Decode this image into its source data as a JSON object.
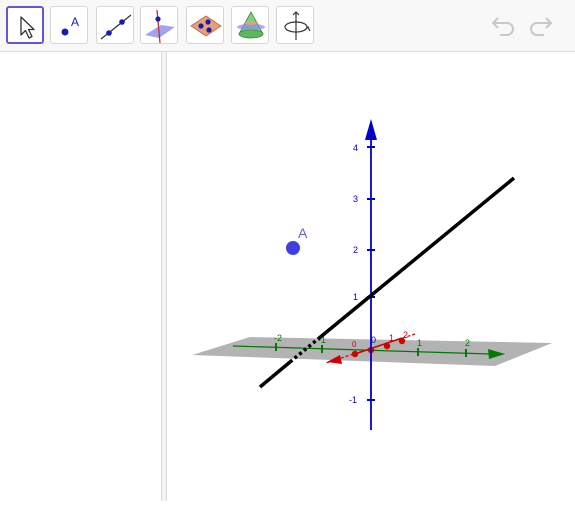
{
  "toolbar": {
    "tools": [
      {
        "name": "move-tool"
      },
      {
        "name": "point-tool",
        "label": "A"
      },
      {
        "name": "line-tool"
      },
      {
        "name": "perpendicular-line-tool"
      },
      {
        "name": "plane-through-points-tool"
      },
      {
        "name": "pyramid-tool"
      },
      {
        "name": "rotate-view-tool"
      }
    ],
    "undo_icon": "undo-icon",
    "redo_icon": "redo-icon"
  },
  "graphics": {
    "z_ticks": [
      "4",
      "3",
      "2",
      "1",
      "-1"
    ],
    "y_ticks": [
      "-2",
      "-1",
      "1",
      "2"
    ],
    "x_ticks": [
      "2",
      "1",
      "0"
    ],
    "origin_label": "0",
    "point_label": "A",
    "colors": {
      "z_axis": "#0000cc",
      "y_axis": "#007a00",
      "x_axis": "#d00000",
      "point": "#4040e0",
      "line": "#000000",
      "plane": "#9a9a9a",
      "accent": "#6557d2"
    }
  }
}
